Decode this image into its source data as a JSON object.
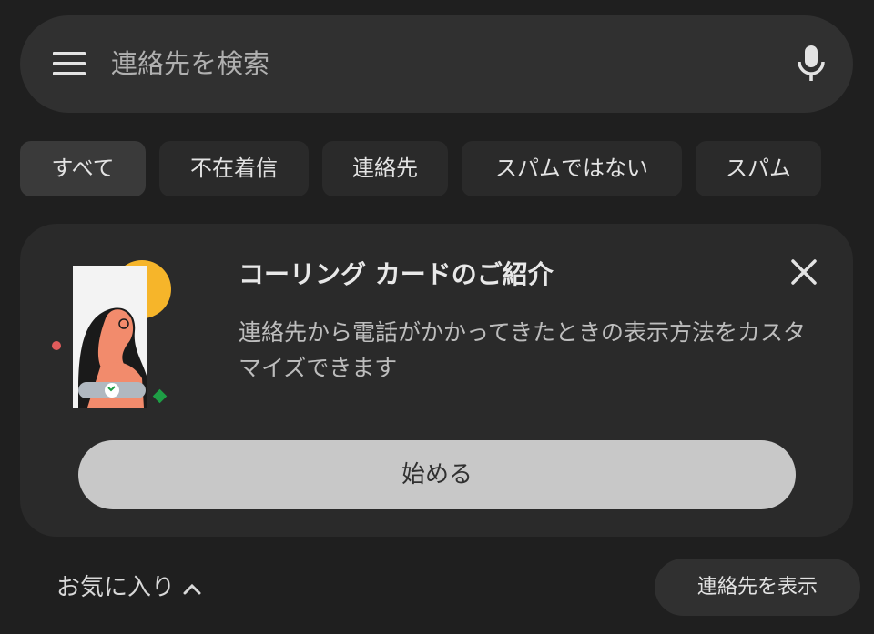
{
  "search": {
    "placeholder": "連絡先を検索"
  },
  "filters": [
    {
      "label": "すべて",
      "active": true
    },
    {
      "label": "不在着信",
      "active": false
    },
    {
      "label": "連絡先",
      "active": false
    },
    {
      "label": "スパムではない",
      "active": false
    },
    {
      "label": "スパム",
      "active": false
    }
  ],
  "promo_card": {
    "title": "コーリング カードのご紹介",
    "body": "連絡先から電話がかかってきたときの表示方法をカスタマイズできます",
    "button_label": "始める"
  },
  "favorites": {
    "label": "お気に入り"
  },
  "show_contacts_label": "連絡先を表示",
  "colors": {
    "background": "#1f1f1f",
    "surface": "#2a2a2a",
    "button": "#c8c8c8",
    "sun": "#f6b52a",
    "accent_red": "#e05b5b",
    "accent_green": "#1e9e45"
  }
}
